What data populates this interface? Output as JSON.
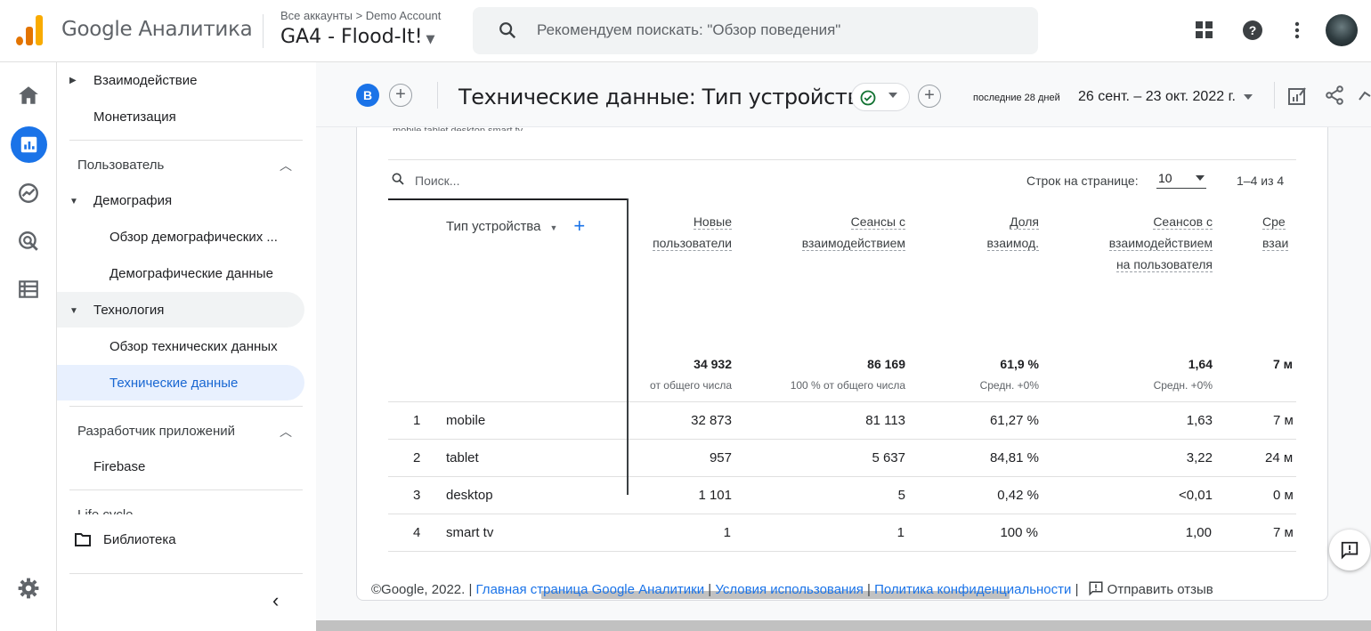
{
  "app": {
    "brand": "Google Аналитика",
    "account_crumb": "Все аккаунты > Demo Account",
    "property": "GA4 - Flood-It!",
    "search_placeholder": "Рекомендуем поискать: \"Обзор поведения\""
  },
  "nav": {
    "item_engagement": "Взаимодействие",
    "item_monetization": "Монетизация",
    "section_user": "Пользователь",
    "item_demographics": "Демография",
    "item_demo_overview": "Обзор демографических ...",
    "item_demo_details": "Демографические данные",
    "item_tech": "Технология",
    "item_tech_overview": "Обзор технических данных",
    "item_tech_details": "Технические данные",
    "section_appdev": "Разработчик приложений",
    "item_firebase": "Firebase",
    "section_lifecycle": "Life cycle",
    "library": "Библиотека"
  },
  "report": {
    "badge": "B",
    "title": "Технические данные: Тип устройства",
    "date_label": "последние 28 дней",
    "date_range": "26 сент. – 23 окт. 2022 г.",
    "legend_partial": "mobile   tablet   desktop   smart tv"
  },
  "table": {
    "search_placeholder": "Поиск...",
    "rows_per_page_label": "Строк на странице:",
    "rows_per_page_value": "10",
    "page_info": "1–4 из 4",
    "dimension_header": "Тип устройства",
    "columns": [
      {
        "l1": "Новые",
        "l2": "пользователи",
        "l3": "",
        "total": "34 932",
        "sub": "от общего числа"
      },
      {
        "l1": "Сеансы с",
        "l2": "взаимодействием",
        "l3": "",
        "total": "86 169",
        "sub": "100 % от общего числа"
      },
      {
        "l1": "Доля",
        "l2": "взаимод.",
        "l3": "",
        "total": "61,9 %",
        "sub": "Средн. +0%"
      },
      {
        "l1": "Сеансов с",
        "l2": "взаимодействием",
        "l3": "на пользователя",
        "total": "1,64",
        "sub": "Средн. +0%"
      },
      {
        "l1": "Сре",
        "l2": "взаи",
        "l3": "",
        "total": "7 м",
        "sub": ""
      }
    ],
    "rows": [
      {
        "idx": "1",
        "name": "mobile",
        "c1": "32 873",
        "c2": "81 113",
        "c3": "61,27 %",
        "c4": "1,63",
        "c5": "7 м"
      },
      {
        "idx": "2",
        "name": "tablet",
        "c1": "957",
        "c2": "5 637",
        "c3": "84,81 %",
        "c4": "3,22",
        "c5": "24 м"
      },
      {
        "idx": "3",
        "name": "desktop",
        "c1": "1 101",
        "c2": "5",
        "c3": "0,42 %",
        "c4": "<0,01",
        "c5": "0 м"
      },
      {
        "idx": "4",
        "name": "smart tv",
        "c1": "1",
        "c2": "1",
        "c3": "100 %",
        "c4": "1,00",
        "c5": "7 м"
      }
    ]
  },
  "footer": {
    "copyright": "©Google, 2022. |",
    "link_home": "Главная страница Google Аналитики",
    "sep1": "|",
    "link_terms": "Условия использования",
    "sep2": "|",
    "link_privacy": "Политика конфиденциальности",
    "sep3": "|",
    "feedback": "Отправить отзыв"
  },
  "colors": {
    "accent": "#1a73e8",
    "logo_orange": "#f9ab00",
    "logo_dark": "#e37400",
    "active_nav_bg": "#e8f0fe"
  }
}
